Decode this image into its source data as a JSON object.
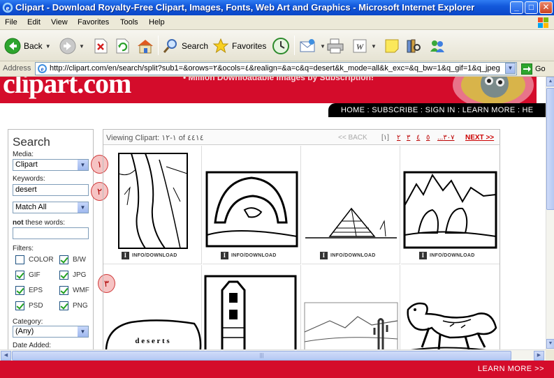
{
  "window": {
    "title": "Clipart - Download Royalty-Free Clipart, Images, Fonts, Web Art and Graphics - Microsoft Internet Explorer",
    "min_glyph": "_",
    "max_glyph": "□",
    "close_glyph": "✕"
  },
  "menu": [
    "File",
    "Edit",
    "View",
    "Favorites",
    "Tools",
    "Help"
  ],
  "toolbar": {
    "back": "Back",
    "search": "Search",
    "favorites": "Favorites"
  },
  "address": {
    "label": "Address",
    "url": "http://clipart.com/en/search/split?sub1=&orows=٢&ocols=٤&realign=&a=c&q=desert&k_mode=all&k_exc=&q_bw=1&q_gif=1&q_jpeg",
    "go": "Go"
  },
  "banner": {
    "logo": "clipart.com",
    "tagline": "• Million Downloadable Images by Subscription!"
  },
  "nav": "HOME : SUBSCRIBE : SIGN IN : LEARN MORE : HE",
  "sidebar": {
    "title": "Search",
    "media_label": "Media:",
    "media_value": "Clipart",
    "keywords_label": "Keywords:",
    "keywords_value": "desert",
    "match_value": "Match All",
    "not_bold": "not",
    "not_rest": " these words:",
    "not_value": "",
    "filters_label": "Filters:",
    "filters": [
      {
        "label": "COLOR",
        "checked": false
      },
      {
        "label": "B/W",
        "checked": true
      },
      {
        "label": "GIF",
        "checked": true
      },
      {
        "label": "JPG",
        "checked": true
      },
      {
        "label": "EPS",
        "checked": true
      },
      {
        "label": "WMF",
        "checked": true
      },
      {
        "label": "PSD",
        "checked": true
      },
      {
        "label": "PNG",
        "checked": true
      }
    ],
    "category_label": "Category:",
    "category_value": "(Any)",
    "date_label": "Date Added:"
  },
  "markers": [
    "١",
    "٢",
    "٣"
  ],
  "results": {
    "viewing": "Viewing Clipart: ١-١٢ of ٤٤١٤",
    "back": "<< BACK",
    "pages": [
      "[١]",
      "٢",
      "٣",
      "٤",
      "٥",
      "...٣٠٧"
    ],
    "next": "NEXT >>",
    "info_label": "INFO/DOWNLOAD",
    "desert_text": "d e s e r t s"
  },
  "footer": {
    "learn_more": "LEARN MORE >>"
  },
  "colors": {
    "brand_red": "#d40c2b",
    "xp_blue": "#0a46c8",
    "chrome": "#ece9d8"
  }
}
